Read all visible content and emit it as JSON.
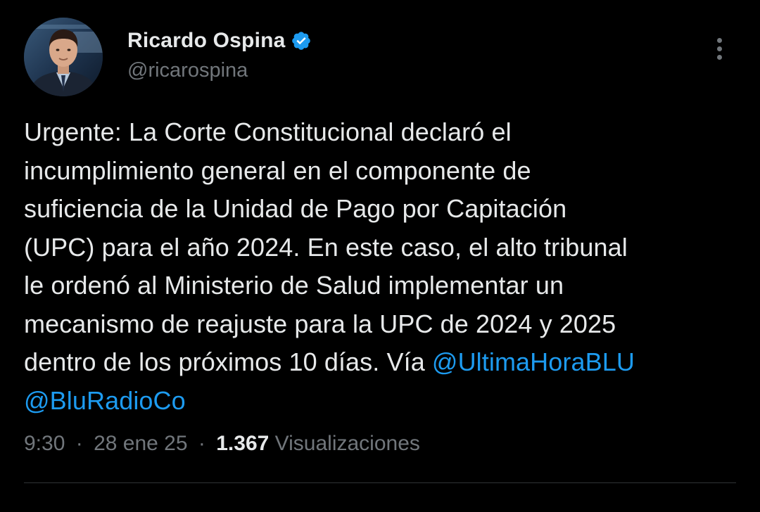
{
  "tweet": {
    "author": {
      "display_name": "Ricardo Ospina",
      "handle": "@ricarospina",
      "verified": true
    },
    "text_lines": [
      "Urgente: La Corte Constitucional declaró el",
      "incumplimiento general en el componente de",
      "suficiencia de la Unidad de Pago por Capitación",
      "(UPC) para el año 2024. En este caso, el alto tribunal",
      "le ordenó al Ministerio de Salud implementar un",
      "mecanismo de reajuste para la UPC de 2024 y 2025",
      "dentro de los próximos 10 días. Vía "
    ],
    "mentions": [
      "@UltimaHoraBLU",
      "@BluRadioCo"
    ],
    "time": "9:30",
    "date": "28 ene 25",
    "views_count": "1.367",
    "views_label": "Visualizaciones",
    "separator": "·"
  },
  "colors": {
    "background": "#000000",
    "text": "#e7e9ea",
    "secondary": "#71767b",
    "link": "#1d9bf0",
    "divider": "#2f3336"
  },
  "icons": {
    "verified": "verified-badge-icon",
    "more": "more-options-icon"
  }
}
